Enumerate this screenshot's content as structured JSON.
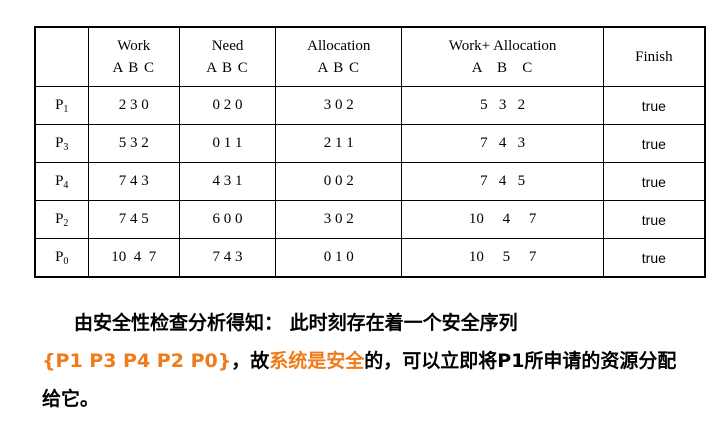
{
  "table": {
    "headers": [
      {
        "line1": "",
        "line2": ""
      },
      {
        "line1": "Work",
        "line2": "A B C"
      },
      {
        "line1": "Need",
        "line2": "A B C"
      },
      {
        "line1": "Allocation",
        "line2": "A B C"
      },
      {
        "line1": "Work+ Allocation",
        "line2": "A   B   C"
      },
      {
        "line1": "Finish",
        "line2": ""
      }
    ],
    "rows": [
      {
        "proc": "P",
        "sub": "1",
        "work": "2 3 0",
        "need": "0 2 0",
        "alloc": "3 0 2",
        "sum": "5   3   2",
        "finish": "true"
      },
      {
        "proc": "P",
        "sub": "3",
        "work": "5 3 2",
        "need": "0 1 1",
        "alloc": "2 1 1",
        "sum": "7   4   3",
        "finish": "true"
      },
      {
        "proc": "P",
        "sub": "4",
        "work": "7 4 3",
        "need": "4 3 1",
        "alloc": "0 0 2",
        "sum": "7   4   5",
        "finish": "true"
      },
      {
        "proc": "P",
        "sub": "2",
        "work": "7 4 5",
        "need": "6 0 0",
        "alloc": "3 0 2",
        "sum": "10     4     7",
        "finish": "true"
      },
      {
        "proc": "P",
        "sub": "0",
        "work": "10  4  7",
        "need": "7 4 3",
        "alloc": "0 1 0",
        "sum": "10     5     7",
        "finish": "true"
      }
    ]
  },
  "paragraph": {
    "part1": "由安全性检查分析得知：  此时刻存在着一个安全序列",
    "sequence": "{P1  P3  P4  P2  P0}",
    "part2": "，故",
    "highlight": "系统是安全",
    "part3": "的，可以立即将P1所申请的资源分配给它。"
  },
  "colors": {
    "accent": "#f07b1a"
  }
}
